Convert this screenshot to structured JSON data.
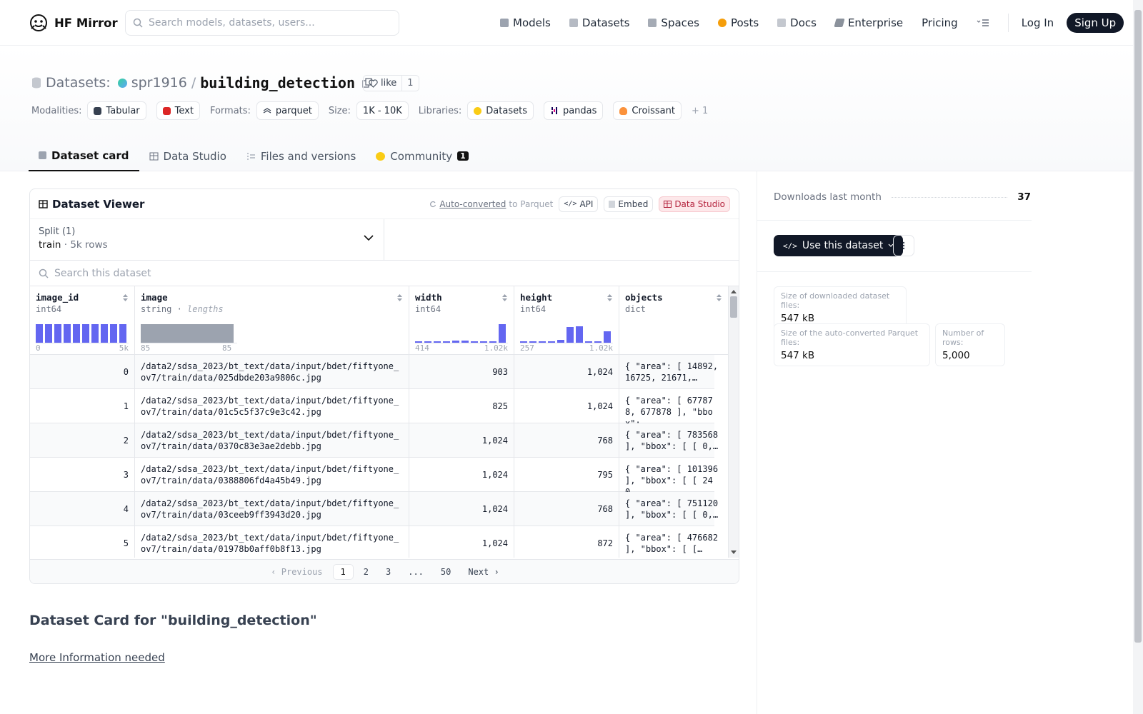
{
  "nav": {
    "brand": "HF Mirror",
    "search_placeholder": "Search models, datasets, users...",
    "links": [
      "Models",
      "Datasets",
      "Spaces",
      "Posts",
      "Docs",
      "Enterprise",
      "Pricing"
    ],
    "login": "Log In",
    "signup": "Sign Up"
  },
  "header": {
    "category": "Datasets:",
    "owner": "spr1916",
    "slash": "/",
    "name": "building_detection",
    "like_label": "like",
    "like_count": "1",
    "modalities_label": "Modalities:",
    "modalities": [
      "Tabular",
      "Text"
    ],
    "formats_label": "Formats:",
    "formats": [
      "parquet"
    ],
    "size_label": "Size:",
    "size": "1K - 10K",
    "libraries_label": "Libraries:",
    "libraries": [
      "Datasets",
      "pandas",
      "Croissant"
    ],
    "libraries_more": "+ 1"
  },
  "tabs": {
    "card": "Dataset card",
    "studio": "Data Studio",
    "files": "Files and versions",
    "community": "Community",
    "community_count": "1"
  },
  "viewer": {
    "title": "Dataset Viewer",
    "auto_converted": "Auto-converted",
    "to_parquet": "to Parquet",
    "api": "API",
    "embed": "Embed",
    "studio": "Data Studio",
    "split_label": "Split (1)",
    "split_name": "train",
    "split_sep": "·",
    "split_rows": "5k rows",
    "search_placeholder": "Search this dataset",
    "columns": [
      {
        "name": "image_id",
        "type": "int64",
        "min": "0",
        "max": "5k"
      },
      {
        "name": "image",
        "type": "string",
        "type_extra": "lengths",
        "min": "85",
        "max": "85"
      },
      {
        "name": "width",
        "type": "int64",
        "min": "414",
        "max": "1.02k"
      },
      {
        "name": "height",
        "type": "int64",
        "min": "257",
        "max": "1.02k"
      },
      {
        "name": "objects",
        "type": "dict"
      }
    ],
    "hist_image_id": [
      1,
      1,
      1,
      1,
      1,
      1,
      1,
      1,
      1,
      1
    ],
    "hist_width": [
      0.04,
      0.04,
      0.04,
      0.04,
      0.12,
      0.12,
      0.06,
      0.04,
      0.04,
      1.0
    ],
    "hist_height": [
      0.04,
      0.04,
      0.04,
      0.04,
      0.16,
      0.85,
      0.9,
      0.04,
      0.04,
      0.62
    ],
    "rows": [
      {
        "id": "0",
        "image": "/data2/sdsa_2023/bt_text/data/input/bdet/fiftyone_ov7/train/data/025dbde203a9806c.jpg",
        "width": "903",
        "height": "1,024",
        "objects": "{ \"area\": [ 14892, 16725, 21671,…"
      },
      {
        "id": "1",
        "image": "/data2/sdsa_2023/bt_text/data/input/bdet/fiftyone_ov7/train/data/01c5c5f37c9e3c42.jpg",
        "width": "825",
        "height": "1,024",
        "objects": "{ \"area\": [ 677878, 677878 ], \"bbox\": …"
      },
      {
        "id": "2",
        "image": "/data2/sdsa_2023/bt_text/data/input/bdet/fiftyone_ov7/train/data/0370c83e3ae2debb.jpg",
        "width": "1,024",
        "height": "768",
        "objects": "{ \"area\": [ 783568 ], \"bbox\": [ [ 0,…"
      },
      {
        "id": "3",
        "image": "/data2/sdsa_2023/bt_text/data/input/bdet/fiftyone_ov7/train/data/0388806fd4a45b49.jpg",
        "width": "1,024",
        "height": "795",
        "objects": "{ \"area\": [ 101396 ], \"bbox\": [ [ 240…"
      },
      {
        "id": "4",
        "image": "/data2/sdsa_2023/bt_text/data/input/bdet/fiftyone_ov7/train/data/03ceeb9ff3943d20.jpg",
        "width": "1,024",
        "height": "768",
        "objects": "{ \"area\": [ 751120 ], \"bbox\": [ [ 0,…"
      },
      {
        "id": "5",
        "image": "/data2/sdsa_2023/bt_text/data/input/bdet/fiftyone_ov7/train/data/01978b0aff0b8f13.jpg",
        "width": "1,024",
        "height": "872",
        "objects": "{ \"area\": [ 476682 ], \"bbox\": [ […"
      }
    ],
    "pager": {
      "prev": "Previous",
      "pages": [
        "1",
        "2",
        "3",
        "...",
        "50"
      ],
      "next": "Next"
    }
  },
  "card": {
    "title": "Dataset Card for \"building_detection\"",
    "link": "More Information needed"
  },
  "sidebar": {
    "downloads_label": "Downloads last month",
    "downloads_value": "37",
    "use_button": "Use this dataset",
    "stats": [
      {
        "k": "Size of downloaded dataset files:",
        "v": "547 kB"
      },
      {
        "k": "Size of the auto-converted Parquet files:",
        "v": "547 kB"
      },
      {
        "k": "Number of rows:",
        "v": "5,000"
      }
    ]
  },
  "colors": {
    "accent": "#6366f1",
    "dark": "#111827",
    "studio_red": "#b4233d"
  }
}
